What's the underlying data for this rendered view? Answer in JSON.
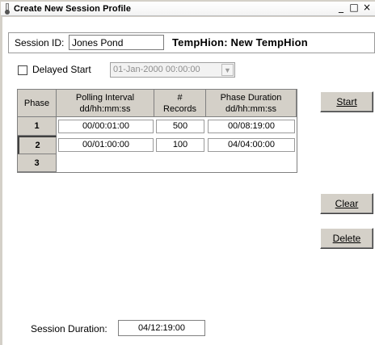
{
  "window": {
    "title": "Create New Session Profile",
    "minimize_glyph": "_",
    "restore_glyph": "□",
    "close_glyph": "×"
  },
  "session": {
    "id_label": "Session ID:",
    "id_value": "Jones Pond",
    "device_label": "TempHion: New TempHion"
  },
  "delayed_start": {
    "label": "Delayed Start",
    "checked": false,
    "datetime": "01-Jan-2000 00:00:00",
    "enabled": false
  },
  "grid": {
    "headers": {
      "phase": "Phase",
      "polling": [
        "Polling Interval",
        "dd/hh:mm:ss"
      ],
      "records": [
        "#",
        "Records"
      ],
      "duration": [
        "Phase Duration",
        "dd/hh:mm:ss"
      ]
    },
    "rows": [
      {
        "phase": "1",
        "polling": "00/00:01:00",
        "records": "500",
        "duration": "00/08:19:00"
      },
      {
        "phase": "2",
        "polling": "00/01:00:00",
        "records": "100",
        "duration": "04/04:00:00"
      },
      {
        "phase": "3",
        "polling": "",
        "records": "",
        "duration": ""
      }
    ]
  },
  "buttons": {
    "start": "Start",
    "clear": "Clear",
    "delete": "Delete"
  },
  "session_duration": {
    "label": "Session Duration:",
    "value": "04/12:19:00"
  },
  "colors": {
    "face": "#d4d0c8",
    "title_bg": "#ffffff",
    "disabled_text": "#8d8d8d"
  }
}
